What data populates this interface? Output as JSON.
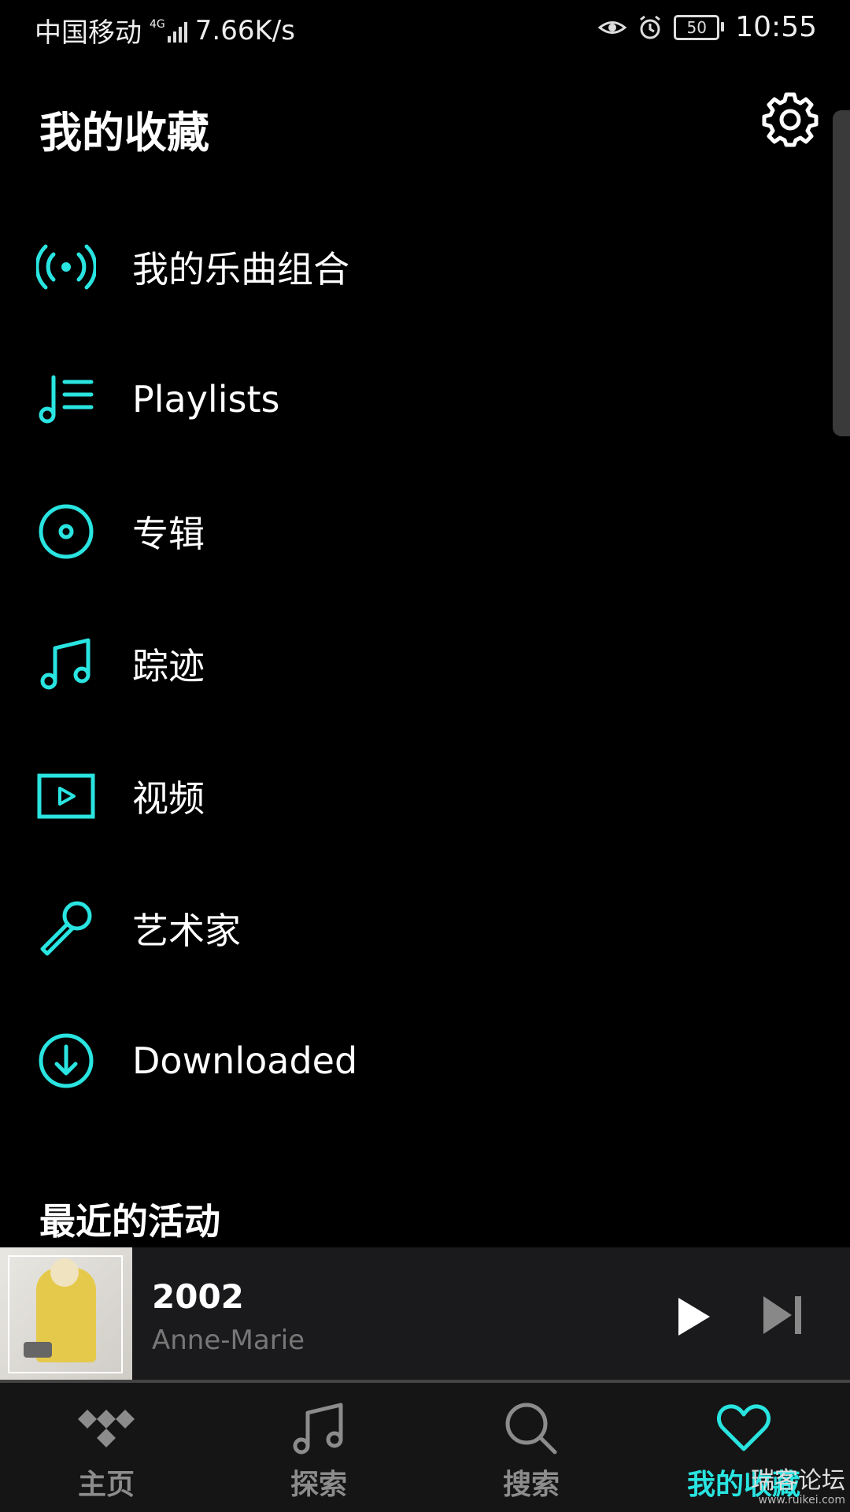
{
  "status_bar": {
    "carrier": "中国移动",
    "network": "4G",
    "speed": "7.66K/s",
    "battery": "50",
    "time": "10:55"
  },
  "header": {
    "title": "我的收藏"
  },
  "menu": {
    "items": [
      {
        "label": "我的乐曲组合",
        "icon": "broadcast-icon"
      },
      {
        "label": "Playlists",
        "icon": "playlist-icon"
      },
      {
        "label": "专辑",
        "icon": "album-icon"
      },
      {
        "label": "踪迹",
        "icon": "music-note-icon"
      },
      {
        "label": "视频",
        "icon": "video-icon"
      },
      {
        "label": "艺术家",
        "icon": "microphone-icon"
      },
      {
        "label": "Downloaded",
        "icon": "download-icon"
      }
    ]
  },
  "recent": {
    "heading": "最近的活动"
  },
  "now_playing": {
    "title": "2002",
    "artist": "Anne-Marie"
  },
  "tabs": [
    {
      "label": "主页",
      "icon": "tidal-logo-icon",
      "active": false
    },
    {
      "label": "探索",
      "icon": "music-note-icon",
      "active": false
    },
    {
      "label": "搜索",
      "icon": "search-icon",
      "active": false
    },
    {
      "label": "我的收藏",
      "icon": "heart-icon",
      "active": true
    }
  ],
  "watermark": {
    "text": "瑞客论坛",
    "url": "www.ruikei.com"
  },
  "colors": {
    "accent": "#29e4e0",
    "background": "#000000",
    "player_bg": "#1a1a1c"
  }
}
